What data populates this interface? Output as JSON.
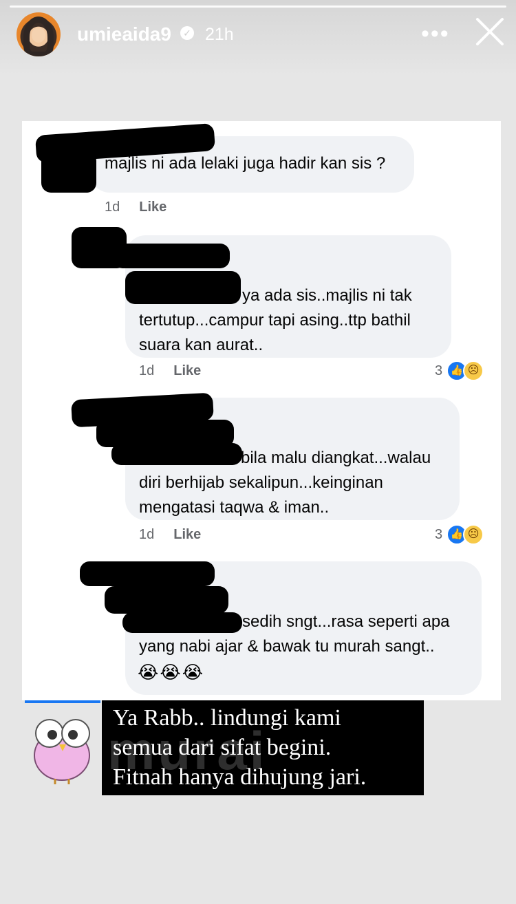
{
  "story": {
    "username": "umieaida9",
    "time": "21h"
  },
  "comments": [
    {
      "text": "majlis ni ada lelaki juga hadir kan sis ?",
      "time": "1d",
      "like_label": "Like"
    },
    {
      "lines": [
        "ya ada sis..majlis ni tak",
        "tertutup...campur tapi asing..ttp bathil",
        "suara kan aurat.."
      ],
      "time": "1d",
      "like_label": "Like",
      "reaction_count": "3"
    },
    {
      "lines": [
        "bila malu diangkat...walau",
        "diri berhijab sekalipun...keinginan",
        "mengatasi taqwa & iman.."
      ],
      "time": "1d",
      "like_label": "Like",
      "reaction_count": "3"
    },
    {
      "lines": [
        "sedih sngt...rasa seperti apa",
        "yang nabi ajar & bawak tu murah sangt.."
      ],
      "emojis": "😭😭😭"
    }
  ],
  "caption": {
    "lines": [
      "Ya Rabb.. lindungi kami",
      "semua dari sifat begini.",
      "Fitnah hanya dihujung jari."
    ],
    "watermark": "murai"
  },
  "icons": {
    "verified": "verified-badge-icon",
    "more": "more-options-icon",
    "close": "close-icon",
    "like": "like-reaction-icon",
    "sad": "sad-reaction-icon"
  },
  "colors": {
    "facebook_blue": "#1877f2",
    "bubble": "#f0f2f5"
  }
}
